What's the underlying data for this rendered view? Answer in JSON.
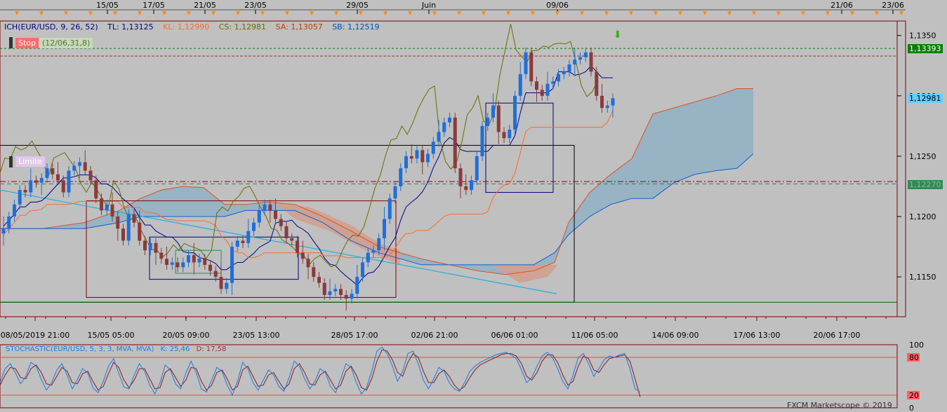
{
  "chart_data": {
    "type": "candlestick",
    "symbol": "EUR/USD",
    "top_date_labels": [
      "15/05",
      "17/05",
      "21/05",
      "23/05",
      "29/05",
      "Juin",
      "09/06",
      "21/06",
      "23/06"
    ],
    "bottom_date_labels": [
      "08/05/2019 21:00",
      "15/05 05:00",
      "20/05 09:00",
      "23/05 13:00",
      "28/05 17:00",
      "02/06 21:00",
      "06/06 01:00",
      "11/06 05:00",
      "14/06 09:00",
      "17/06 13:00",
      "20/06 17:00"
    ],
    "price_ticks": [
      "1,1350",
      "1,1300",
      "1,1250",
      "1,1200",
      "1,1150"
    ],
    "ylim": [
      1.1117,
      1.1362
    ],
    "indicator": {
      "name": "ICH(EUR/USD, 9, 26, 52)",
      "tl": "TL: 1,13125",
      "kl": "KL: 1,12990",
      "cs": "CS: 1,12981",
      "sa": "SA: 1,13057",
      "sb": "SB: 1,12519"
    },
    "price_tags": [
      {
        "text": "1,13393",
        "value": 1.13393,
        "bg": "#008000",
        "fg": "#ffffff"
      },
      {
        "text": "1,12981",
        "value": 1.12981,
        "bg": "#66ccff",
        "fg": "#000000"
      },
      {
        "text": "1,12270",
        "value": 1.1227,
        "bg": "#2e8b57",
        "fg": "#8fbc8f"
      }
    ],
    "order_labels": [
      {
        "text": "Stop",
        "suffix": "(12/06,31,8)"
      },
      {
        "text": "Limite"
      }
    ],
    "stochastic": {
      "title": "STOCHASTIC(EUR/USD, 5, 3, 3, MVA, MVA)",
      "k": "K: 25,46",
      "d": "D: 17,58",
      "ticks": [
        "100",
        "80",
        "20",
        "0"
      ],
      "k_values": [
        40,
        62,
        70,
        55,
        38,
        50,
        72,
        66,
        45,
        28,
        40,
        60,
        70,
        52,
        30,
        45,
        62,
        55,
        32,
        24,
        42,
        66,
        78,
        55,
        33,
        30,
        52,
        70,
        58,
        36,
        22,
        40,
        68,
        60,
        38,
        30,
        55,
        74,
        56,
        30,
        25,
        44,
        64,
        58,
        36,
        20,
        42,
        72,
        62,
        40,
        28,
        44,
        60,
        52,
        34,
        26,
        48,
        74,
        66,
        46,
        30,
        42,
        62,
        56,
        34,
        24,
        46,
        70,
        64,
        40,
        22,
        32,
        58,
        90,
        96,
        86,
        66,
        42,
        58,
        86,
        90,
        70,
        44,
        30,
        46,
        64,
        58,
        40,
        30,
        26,
        40,
        58,
        66,
        72,
        76,
        80,
        84,
        86,
        88,
        84,
        78,
        60,
        40,
        48,
        66,
        82,
        88,
        80,
        62,
        42,
        30,
        52,
        80,
        86,
        70,
        50,
        62,
        76,
        82,
        80,
        84,
        86,
        62,
        30,
        25
      ],
      "d_values": [
        36,
        52,
        64,
        62,
        48,
        46,
        62,
        68,
        56,
        38,
        36,
        50,
        64,
        58,
        40,
        38,
        54,
        58,
        42,
        28,
        34,
        54,
        72,
        64,
        44,
        32,
        44,
        62,
        62,
        46,
        30,
        32,
        56,
        62,
        48,
        34,
        44,
        64,
        62,
        42,
        28,
        36,
        56,
        60,
        46,
        28,
        34,
        60,
        66,
        50,
        34,
        36,
        52,
        56,
        42,
        30,
        38,
        62,
        70,
        56,
        38,
        36,
        52,
        58,
        44,
        30,
        36,
        58,
        66,
        52,
        32,
        28,
        46,
        74,
        92,
        90,
        76,
        56,
        50,
        72,
        86,
        80,
        58,
        40,
        40,
        54,
        60,
        50,
        36,
        28,
        34,
        48,
        60,
        68,
        72,
        76,
        80,
        84,
        86,
        86,
        82,
        70,
        50,
        44,
        56,
        74,
        84,
        84,
        72,
        52,
        36,
        42,
        66,
        82,
        78,
        60,
        56,
        68,
        78,
        80,
        82,
        84,
        74,
        46,
        17
      ]
    },
    "watermark": "FXCM Marketscope © 2019"
  }
}
